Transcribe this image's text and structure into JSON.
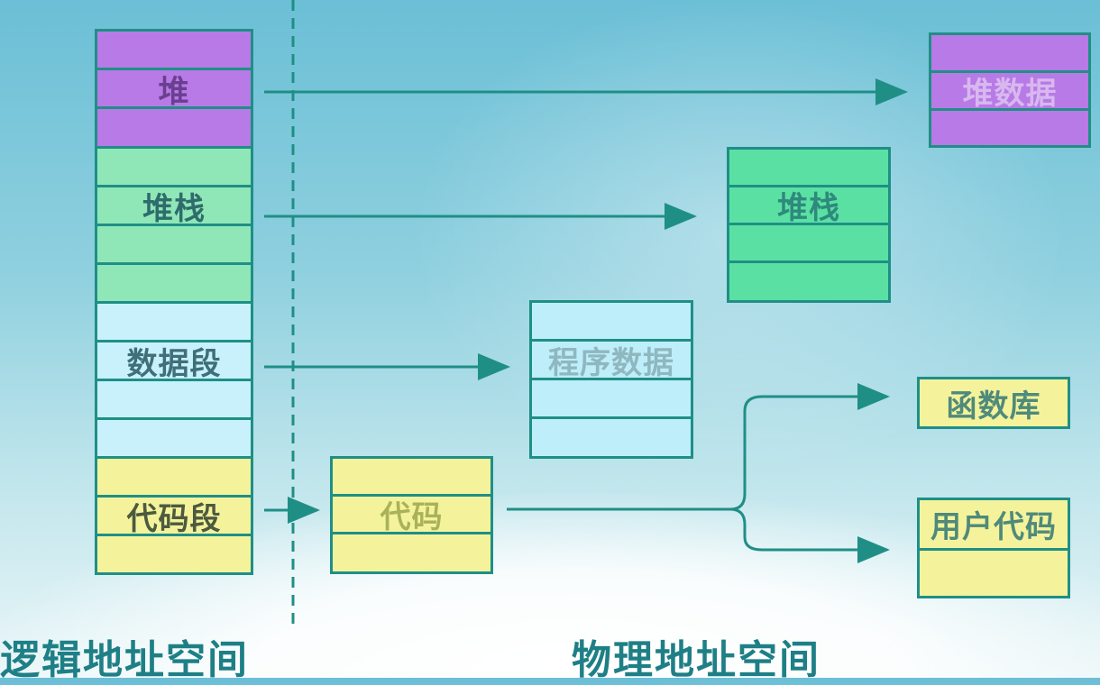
{
  "logical_space": {
    "caption": "逻辑地址空间",
    "segments": {
      "heap": "堆",
      "stack": "堆栈",
      "data": "数据段",
      "code": "代码段"
    }
  },
  "physical_space": {
    "caption": "物理地址空间",
    "blocks": {
      "heap_data": "堆数据",
      "stack": "堆栈",
      "program_data": "程序数据",
      "code": "代码",
      "library": "函数库",
      "user_code": "用户代码"
    }
  },
  "colors": {
    "heap": "#b77ae6",
    "stack": "#8fe7b7",
    "data": "#c8f1fb",
    "code": "#f4f39c",
    "line": "#1f8f86"
  }
}
